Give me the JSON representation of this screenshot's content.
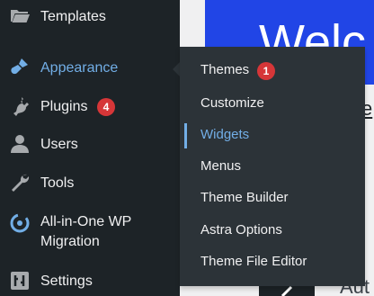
{
  "background": {
    "hero_text": "Welc",
    "link_text": "e",
    "bottom_text": "Aut"
  },
  "colors": {
    "sidebar_bg": "#1d2327",
    "flyout_bg": "#2c3338",
    "accent": "#72aee6",
    "badge": "#d63638",
    "hero_bg": "#2145e6"
  },
  "sidebar": {
    "items": [
      {
        "label": "Templates",
        "icon": "folder-icon",
        "active": false
      },
      {
        "label": "Appearance",
        "icon": "paintbrush-icon",
        "active": true
      },
      {
        "label": "Plugins",
        "icon": "plugin-icon",
        "badge": "4"
      },
      {
        "label": "Users",
        "icon": "users-icon"
      },
      {
        "label": "Tools",
        "icon": "wrench-icon"
      },
      {
        "label_line1": "All-in-One WP",
        "label_line2": "Migration",
        "icon": "migration-icon"
      },
      {
        "label": "Settings",
        "icon": "settings-icon"
      }
    ]
  },
  "flyout": {
    "items": [
      {
        "label": "Themes",
        "badge": "1"
      },
      {
        "label": "Customize"
      },
      {
        "label": "Widgets",
        "hover": true
      },
      {
        "label": "Menus"
      },
      {
        "label": "Theme Builder"
      },
      {
        "label": "Astra Options"
      },
      {
        "label": "Theme File Editor"
      }
    ]
  }
}
